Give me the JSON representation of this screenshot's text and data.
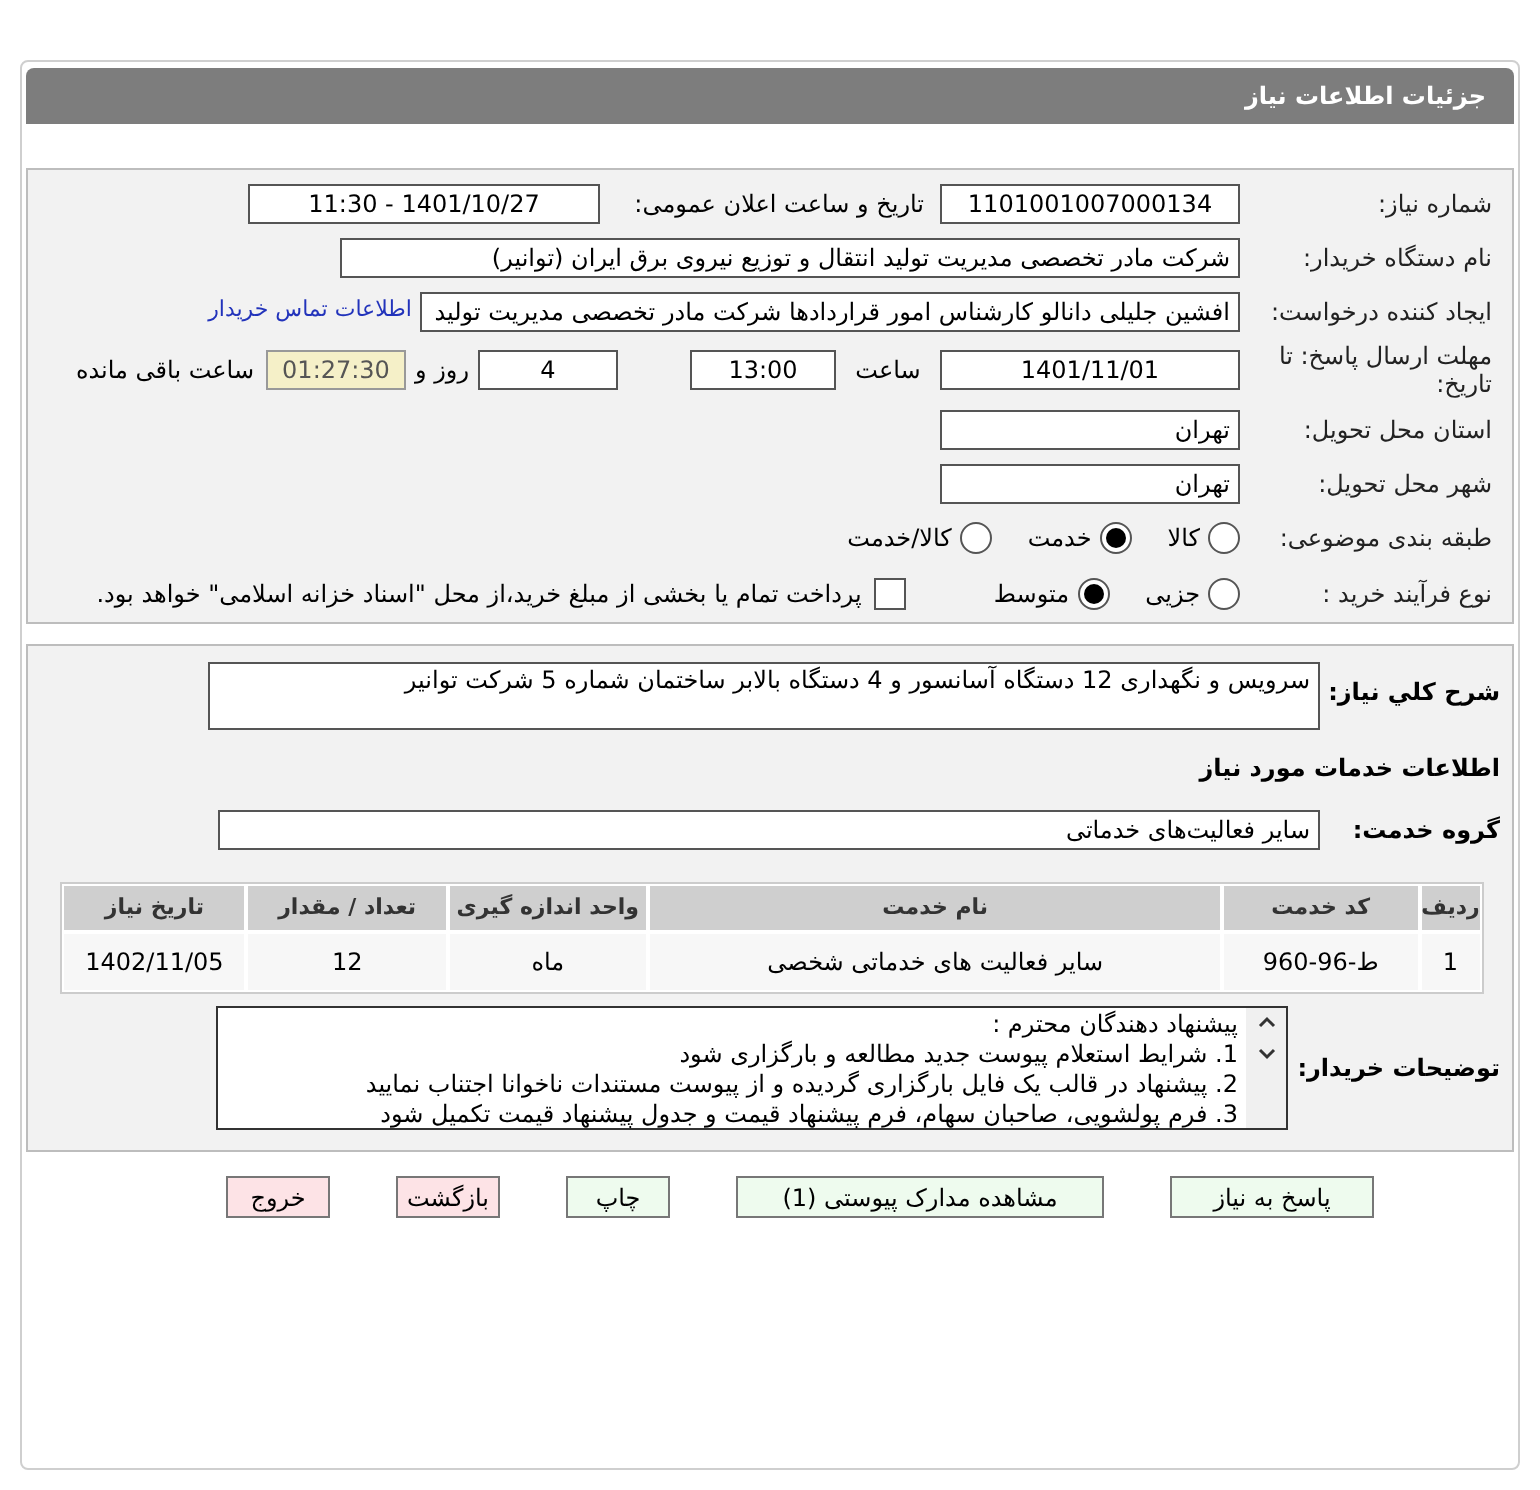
{
  "header": {
    "title": "جزئیات اطلاعات نیاز"
  },
  "need_number": {
    "label": "شماره نیاز:",
    "value": "1101001007000134"
  },
  "announce": {
    "label": "تاریخ و ساعت اعلان عمومی:",
    "value": "1401/10/27 - 11:30"
  },
  "buyer": {
    "label": "نام دستگاه خریدار:",
    "value": "شرکت مادر تخصصی مدیریت تولید  انتقال و توزیع نیروی برق ایران (توانیر)"
  },
  "requester": {
    "label": "ایجاد کننده درخواست:",
    "value": "افشین جلیلی دانالو کارشناس امور قراردادها شرکت مادر تخصصی مدیریت تولید",
    "link": "اطلاعات تماس خریدار"
  },
  "deadline": {
    "label": "مهلت ارسال پاسخ: تا تاریخ:",
    "date": "1401/11/01",
    "time_label": "ساعت",
    "time": "13:00",
    "days": "4",
    "days_label": "روز و",
    "remaining": "01:27:30",
    "remaining_label": "ساعت باقی مانده"
  },
  "province": {
    "label": "استان محل تحویل:",
    "value": "تهران"
  },
  "city": {
    "label": "شهر محل تحویل:",
    "value": "تهران"
  },
  "category": {
    "label": "طبقه بندی موضوعی:",
    "options": [
      {
        "label": "کالا",
        "selected": false
      },
      {
        "label": "خدمت",
        "selected": true
      },
      {
        "label": "کالا/خدمت",
        "selected": false
      }
    ]
  },
  "process": {
    "label": "نوع فرآیند خرید :",
    "options": [
      {
        "label": "جزیی",
        "selected": false
      },
      {
        "label": "متوسط",
        "selected": true
      }
    ],
    "payment": {
      "label": "پرداخت تمام یا بخشی از مبلغ خرید،از محل \"اسناد خزانه اسلامی\" خواهد بود.",
      "checked": false
    }
  },
  "description": {
    "label": "شرح کلي نياز:",
    "value": "سرویس و نگهداری 12 دستگاه آسانسور و 4 دستگاه بالابر ساختمان شماره 5 شرکت توانیر"
  },
  "services_heading": "اطلاعات خدمات مورد نیاز",
  "service_group": {
    "label": "گروه خدمت:",
    "value": "سایر فعالیت‌های خدماتی"
  },
  "table": {
    "columns": [
      "ردیف",
      "کد خدمت",
      "نام خدمت",
      "واحد اندازه گیری",
      "تعداد / مقدار",
      "تاریخ نیاز"
    ],
    "rows": [
      [
        "1",
        "ط-96-960",
        "سایر فعالیت های خدماتی شخصی",
        "ماه",
        "12",
        "1402/11/05"
      ]
    ]
  },
  "buyer_notes": {
    "label": "توضیحات خریدار:",
    "lines": [
      "پیشنهاد دهندگان محترم :",
      "1. شرایط استعلام پیوست جدید مطالعه و بارگزاری شود",
      "2. پیشنهاد در قالب یک فایل بارگزاری گردیده و از پیوست مستندات ناخوانا اجتناب نمایید",
      "3. فرم پولشویی، صاحبان سهام، فرم پیشنهاد قیمت و جدول پیشنهاد قیمت تکمیل شود"
    ]
  },
  "buttons": [
    {
      "label": "پاسخ به نیاز",
      "kind": "normal"
    },
    {
      "label": "مشاهده مدارک پیوستی (1)",
      "kind": "normal"
    },
    {
      "label": "چاپ",
      "kind": "normal"
    },
    {
      "label": "بازگشت",
      "kind": "danger"
    },
    {
      "label": "خروج",
      "kind": "danger"
    }
  ]
}
